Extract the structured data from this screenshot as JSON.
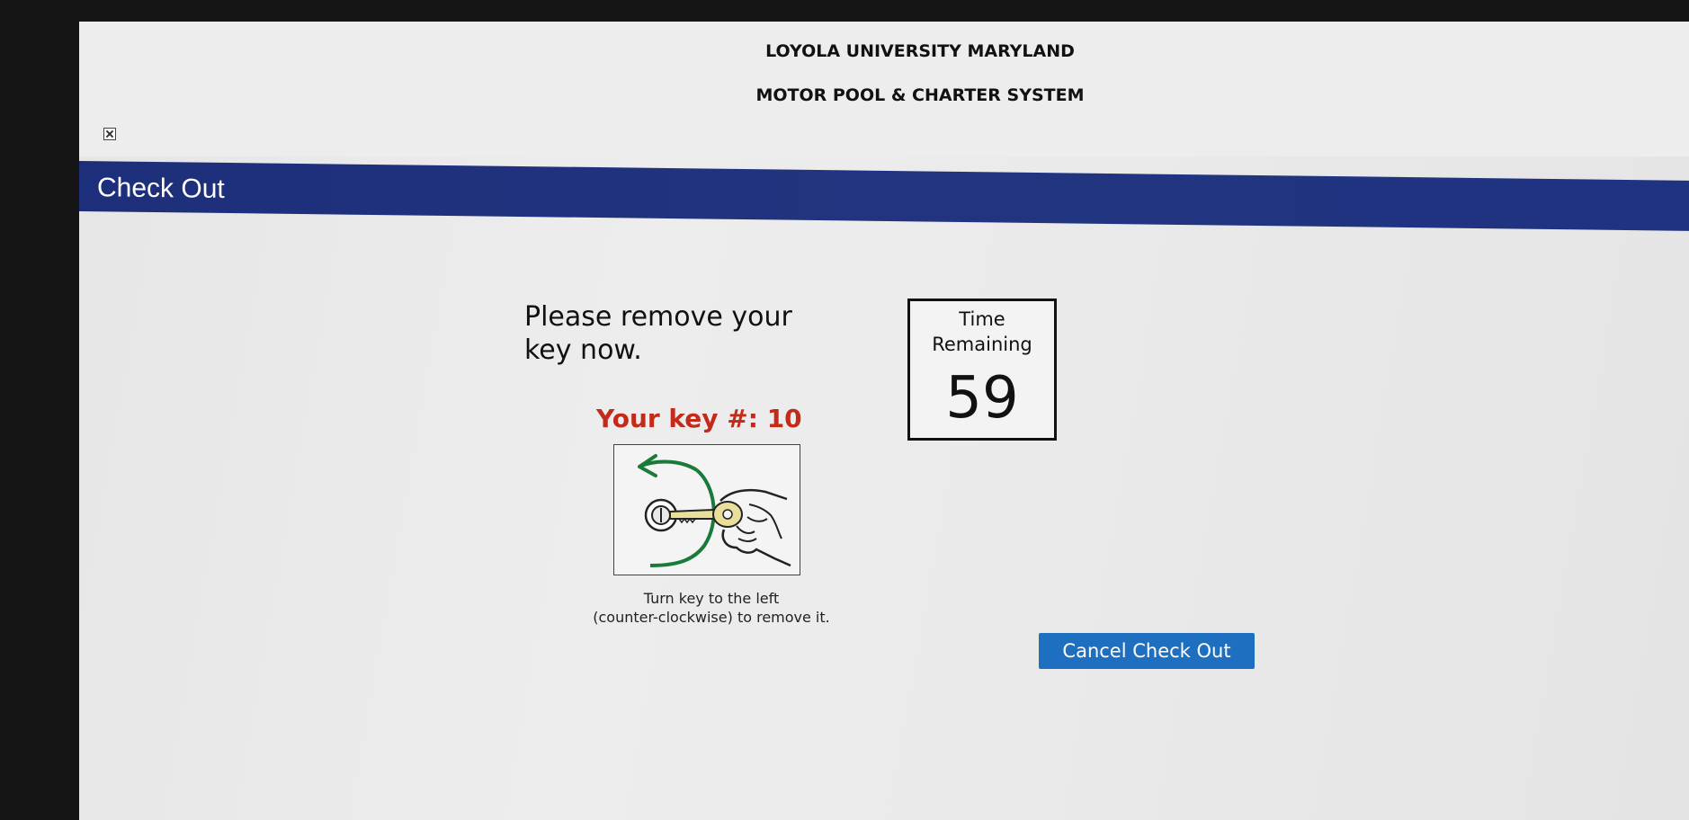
{
  "header": {
    "org_name": "LOYOLA UNIVERSITY MARYLAND",
    "system_name": "MOTOR POOL & CHARTER SYSTEM"
  },
  "title_bar": {
    "title": "Check Out",
    "color": "#1f3382"
  },
  "main": {
    "instruction": "Please remove your key now.",
    "key_number_text": "Your key #: 10",
    "key_number_color": "#c32a1a",
    "illustration_icon": "turn-key-left-icon",
    "caption_line1": "Turn key to the left",
    "caption_line2": "(counter-clockwise) to remove it."
  },
  "timer": {
    "label_line1": "Time",
    "label_line2": "Remaining",
    "value": "59"
  },
  "actions": {
    "cancel_label": "Cancel Check Out",
    "cancel_color": "#1f6fc1"
  }
}
